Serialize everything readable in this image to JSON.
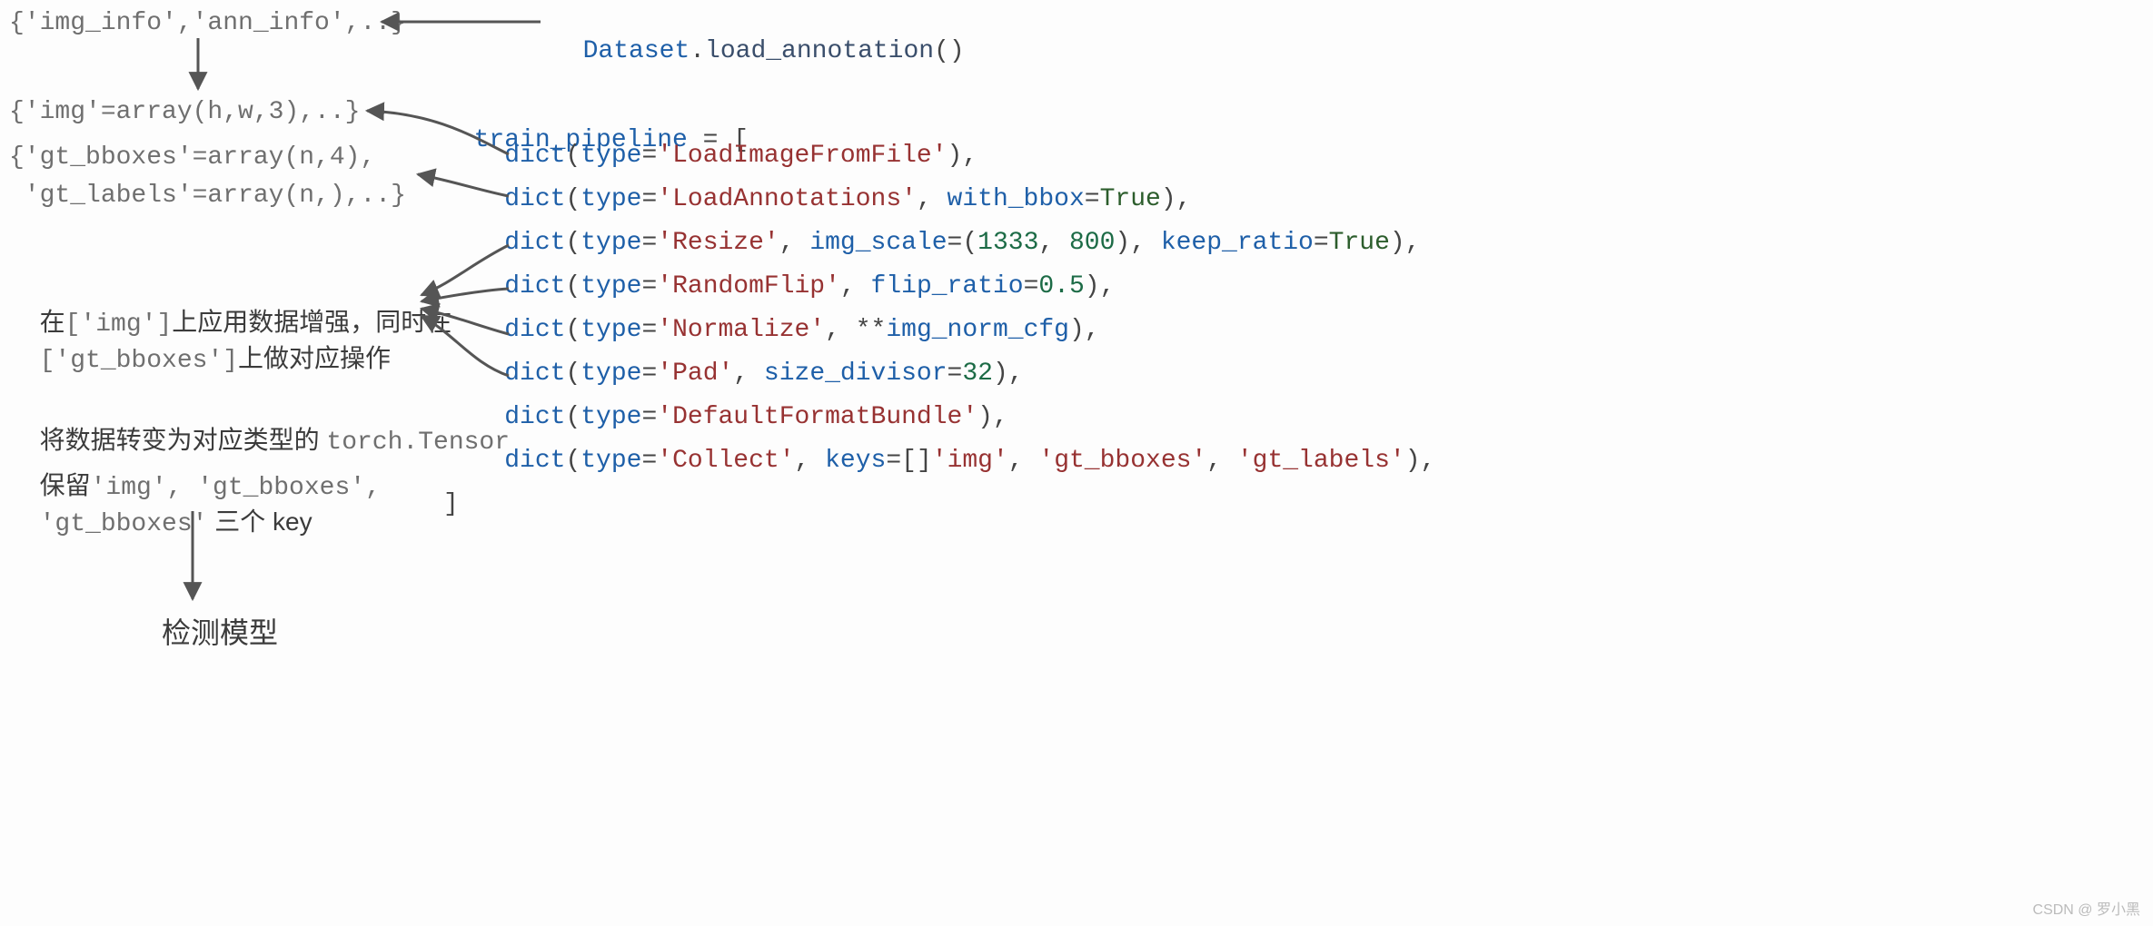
{
  "left": {
    "l1": "{'img_info','ann_info',..}",
    "l2": "{'img'=array(h,w,3),..}",
    "l3a": "{'gt_bboxes'=array(n,4),",
    "l3b": " 'gt_labels'=array(n,),..}",
    "aug_a_pre": "在",
    "aug_a_code": "['img']",
    "aug_a_post": "上应用数据增强，同时在",
    "aug_b_code": "['gt_bboxes']",
    "aug_b_post": "上做对应操作",
    "tensor_a": "将数据转变为对应类型的 ",
    "tensor_b": "torch.Tensor",
    "keep_a": "保留",
    "keep_b": "'img', 'gt_bboxes',",
    "keep_c": "'gt_bboxes'",
    "keep_d": " 三个 key",
    "model": "检测模型"
  },
  "top": {
    "ds": "Dataset",
    "dot": ".",
    "fn": "load_annotation",
    "paren": "()"
  },
  "pipe": {
    "head": "train_pipeline",
    "head2": " = [",
    "close": "]",
    "rows": [
      {
        "pre": "    ",
        "fn": "dict",
        "open": "(",
        "kw": "type",
        "eq": "=",
        "str": "'LoadImageFromFile'",
        "rest": "),"
      },
      {
        "pre": "    ",
        "fn": "dict",
        "open": "(",
        "kw": "type",
        "eq": "=",
        "str": "'LoadAnnotations'",
        "mid": ", ",
        "kw2": "with_bbox",
        "eq2": "=",
        "val2": "True",
        "rest": "),"
      },
      {
        "pre": "    ",
        "fn": "dict",
        "open": "(",
        "kw": "type",
        "eq": "=",
        "str": "'Resize'",
        "mid": ", ",
        "kw2": "img_scale",
        "eq2": "=(",
        "n1": "1333",
        "comma": ", ",
        "n2": "800",
        "close2": "), ",
        "kw3": "keep_ratio",
        "eq3": "=",
        "val3": "True",
        "rest": "),"
      },
      {
        "pre": "    ",
        "fn": "dict",
        "open": "(",
        "kw": "type",
        "eq": "=",
        "str": "'RandomFlip'",
        "mid": ", ",
        "kw2": "flip_ratio",
        "eq2": "=",
        "n1": "0.5",
        "rest": "),"
      },
      {
        "pre": "    ",
        "fn": "dict",
        "open": "(",
        "kw": "type",
        "eq": "=",
        "str": "'Normalize'",
        "mid": ", **",
        "kw2": "img_norm_cfg",
        "rest": "),"
      },
      {
        "pre": "    ",
        "fn": "dict",
        "open": "(",
        "kw": "type",
        "eq": "=",
        "str": "'Pad'",
        "mid": ", ",
        "kw2": "size_divisor",
        "eq2": "=",
        "n1": "32",
        "rest": "),"
      },
      {
        "pre": "    ",
        "fn": "dict",
        "open": "(",
        "kw": "type",
        "eq": "=",
        "str": "'DefaultFormatBundle'",
        "rest": "),"
      },
      {
        "pre": "    ",
        "fn": "dict",
        "open": "(",
        "kw": "type",
        "eq": "=",
        "str": "'Collect'",
        "mid": ", ",
        "kw2": "keys",
        "eq2": "=[",
        "s1": "'img'",
        "c1": ", ",
        "s2": "'gt_bboxes'",
        "c2": ", ",
        "s3": "'gt_labels'",
        "close2": "]",
        "rest": "),"
      }
    ]
  },
  "watermark": "CSDN @ 罗小黑"
}
